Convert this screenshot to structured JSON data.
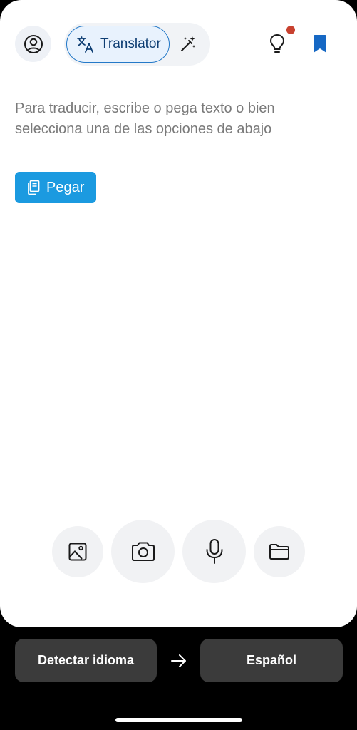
{
  "header": {
    "translator_tab_label": "Translator",
    "icons": {
      "profile": "profile-icon",
      "translate": "translate-icon",
      "magic": "magic-wand-icon",
      "tips": "lightbulb-icon",
      "saved": "bookmark-icon"
    },
    "has_notification": true
  },
  "main": {
    "placeholder": "Para traducir, escribe o pega texto o bien selecciona una de las opciones de abajo",
    "paste_label": "Pegar"
  },
  "input_options": {
    "icons": [
      "image-icon",
      "camera-icon",
      "microphone-icon",
      "folder-icon"
    ]
  },
  "language_bar": {
    "source": "Detectar idioma",
    "target": "Español"
  },
  "colors": {
    "accent": "#1b9ae0",
    "bookmark": "#1668c4",
    "notification": "#c8412f",
    "dark_button": "#3b3b3b"
  }
}
